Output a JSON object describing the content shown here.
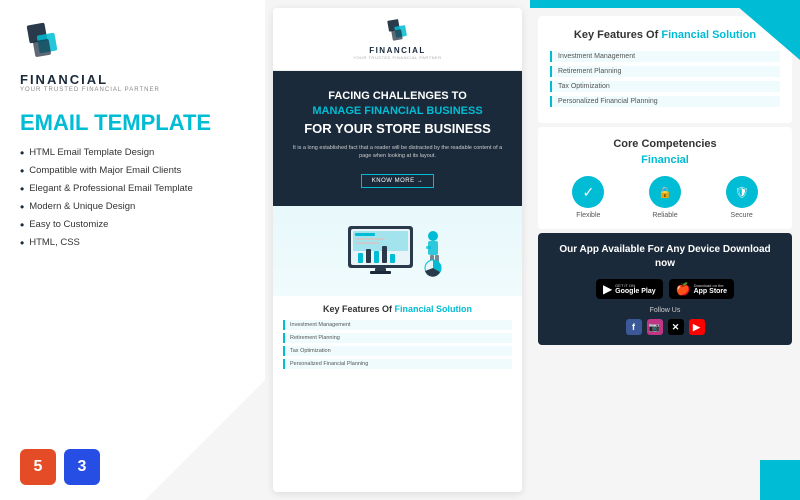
{
  "left": {
    "logo_text": "FINANCIAL",
    "logo_sub": "YOUR TRUSTED FINANCIAL PARTNER",
    "title": "EMAIL TEMPLATE",
    "features": [
      "HTML Email Template Design",
      "Compatible with Major Email Clients",
      "Elegant & Professional Email Template",
      "Modern & Unique Design",
      "Easy to Customize",
      "HTML, CSS"
    ],
    "badge_html": "HTML5",
    "badge_css": "CSS3"
  },
  "middle": {
    "logo_text": "FINANCIAL",
    "logo_sub": "YOUR TRUSTED FINANCIAL PARTNER",
    "hero_line1": "FACING CHALLENGES TO",
    "hero_highlight": "MANAGE FINANCIAL BUSINESS",
    "hero_line2": "FOR YOUR STORE BUSINESS",
    "hero_desc": "It is a long established fact that a reader will be distracted by the readable content of a page when looking at its layout.",
    "hero_btn": "KNOW MORE →",
    "features_title": "Key Features Of",
    "features_highlight": "Financial Solution",
    "features": [
      "Investment Management",
      "Retirement Planning",
      "Tax Optimization",
      "Personalized Financial Planning"
    ]
  },
  "right": {
    "key_features_title": "Key Features Of",
    "key_features_highlight": "Financial Solution",
    "key_features": [
      "Investment Management",
      "Retirement Planning",
      "Tax Optimization",
      "Personalized Financial Planning"
    ],
    "core_title": "Core Competencies",
    "core_highlight": "Financial",
    "competencies": [
      {
        "label": "Flexible",
        "icon": "✓"
      },
      {
        "label": "Reliable",
        "icon": "🔒"
      },
      {
        "label": "Secure",
        "icon": "🛡"
      }
    ],
    "app_title": "Our App Available For Any Device Download now",
    "follow_label": "Follow Us",
    "stores": [
      {
        "small": "GET IT ON",
        "big": "Google Play"
      },
      {
        "small": "Download on the",
        "big": "App Store"
      }
    ]
  }
}
